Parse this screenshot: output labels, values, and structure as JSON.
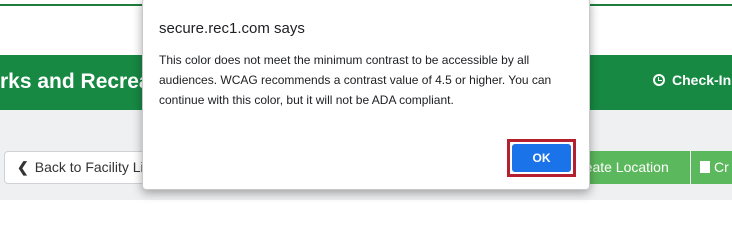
{
  "page": {
    "org_name": "rks and Recrea",
    "checkin_label": "Check-In",
    "back_button_label": "Back to Facility Lis",
    "create_location_label": "reate Location",
    "create_second_label": "Cr"
  },
  "dialog": {
    "title": "secure.rec1.com says",
    "message": "This color does not meet the minimum contrast to be accessible by all audiences. WCAG recommends a contrast value of 4.5 or higher. You can continue with this color, but it will not be ADA compliant.",
    "ok_label": "OK"
  },
  "colors": {
    "header_green": "#178943",
    "action_green": "#5cb85c",
    "ok_blue": "#1a73e8",
    "highlight_red": "#b5202e",
    "gray_band": "#eef0f2"
  },
  "icons": {
    "checkin": "clock-icon",
    "back": "chevron-left-icon",
    "create": "building-icon"
  }
}
